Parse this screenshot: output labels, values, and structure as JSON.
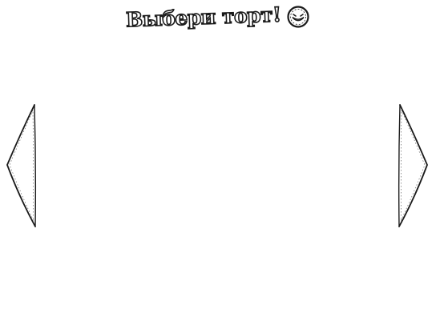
{
  "screen": {
    "title": "Выбери торт!",
    "title_icon": "smiley-face-icon",
    "left_arrow_icon": "left-triangle-arrow-icon",
    "right_arrow_icon": "right-triangle-arrow-icon"
  }
}
